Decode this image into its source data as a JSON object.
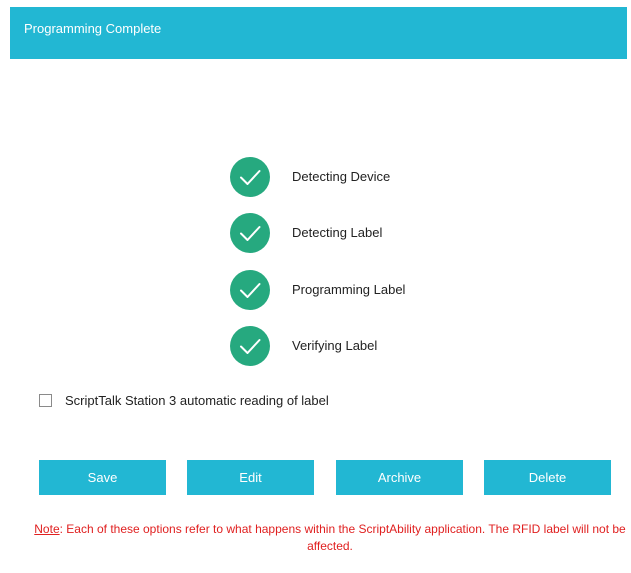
{
  "dialog": {
    "title": "Programming Complete"
  },
  "steps": [
    {
      "label": "Detecting Device",
      "status": "complete",
      "icon": "check-circle-icon"
    },
    {
      "label": "Detecting Label",
      "status": "complete",
      "icon": "check-circle-icon"
    },
    {
      "label": "Programming Label",
      "status": "complete",
      "icon": "check-circle-icon"
    },
    {
      "label": "Verifying Label",
      "status": "complete",
      "icon": "check-circle-icon"
    }
  ],
  "auto_read": {
    "label": "ScriptTalk Station 3 automatic reading of label",
    "checked": false
  },
  "buttons": {
    "save": "Save",
    "edit": "Edit",
    "archive": "Archive",
    "delete": "Delete"
  },
  "note": {
    "label": "Note",
    "text": ": Each of these options refer to what happens within the ScriptAbility application. The RFID label will not be affected."
  },
  "colors": {
    "accent": "#22b7d3",
    "success": "#26a97f",
    "warning_text": "#e02020"
  }
}
